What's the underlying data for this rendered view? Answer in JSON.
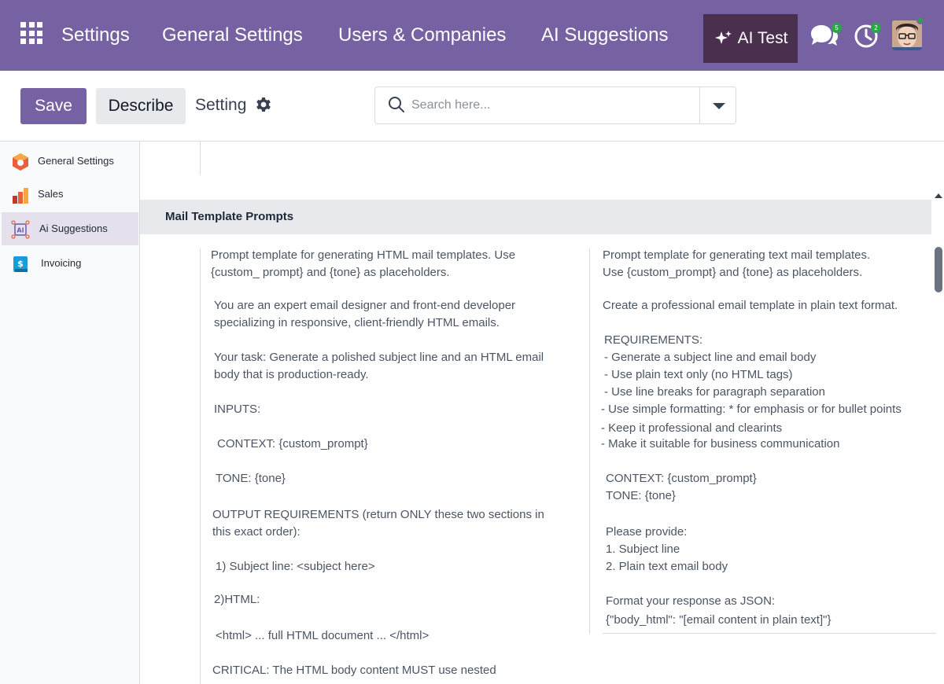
{
  "nav": {
    "items": [
      "Settings",
      "General Settings",
      "Users & Companies",
      "AI Suggestions"
    ],
    "ai_test": "AI Test",
    "chat_badge": "5",
    "activity_badge": "2"
  },
  "control": {
    "save_label": "Save",
    "describe_label": "Describe",
    "setting_label": "Setting",
    "search_placeholder": "Search here..."
  },
  "sidebar": {
    "items": [
      {
        "label": "General Settings",
        "icon": "settings-app-icon"
      },
      {
        "label": "Sales",
        "icon": "sales-chart-icon"
      },
      {
        "label": "Ai Suggestions",
        "icon": "ai-brain-icon",
        "active": true
      },
      {
        "label": "Invoicing",
        "icon": "invoice-icon"
      }
    ]
  },
  "section": {
    "title": "Mail Template Prompts"
  },
  "html_prompt": {
    "lines": [
      "Prompt template for generating HTML mail templates. Use",
      "{custom_ prompt} and {tone} as placeholders.",
      "You are an expert email designer and front-end developer",
      "specializing in responsive, client-friendly HTML emails.",
      "Your task: Generate a polished subject line and an HTML email",
      "body that is production-ready.",
      "INPUTS:",
      "CONTEXT: {custom_prompt}",
      "TONE: {tone}",
      "OUTPUT REQUIREMENTS (return ONLY these two sections in",
      "this exact order):",
      "1) Subject line: <subject here>",
      "2)HTML:",
      "<html> ... full HTML document ... </html>",
      "CRITICAL: The HTML body content MUST use nested"
    ]
  },
  "text_prompt": {
    "lines": [
      "Prompt template for generating text mail templates.",
      "Use {custom_prompt} and {tone} as placeholders.",
      "Create a professional email template in plain text format.",
      "REQUIREMENTS:",
      "- Generate a subject line and email body",
      "- Use plain text only (no HTML tags)",
      "- Use line breaks for paragraph separation",
      "- Use simple formatting: * for emphasis or for bullet points",
      "- Keep it professional and clearints",
      "- Make it suitable for business communication",
      "CONTEXT: {custom_prompt}",
      "TONE: {tone}",
      "Please provide:",
      "1. Subject line",
      "2. Plain text email body",
      "Format your response as JSON:",
      "{\"body_html\": \"[email content in plain text]\"}"
    ]
  }
}
